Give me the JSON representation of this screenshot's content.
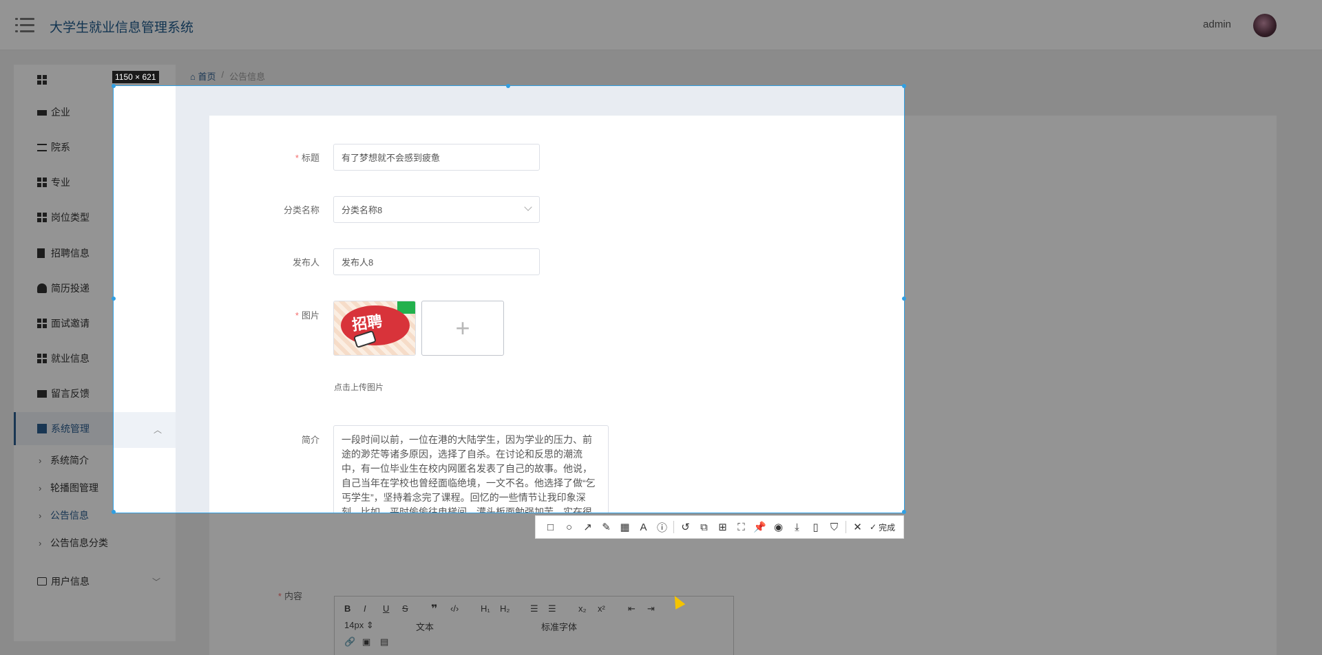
{
  "header": {
    "title": "大学生就业信息管理系统",
    "user": "admin"
  },
  "sidebar": {
    "items": [
      {
        "label": "企业",
        "icon": "store-icon"
      },
      {
        "label": "院系",
        "icon": "list-icon"
      },
      {
        "label": "专业",
        "icon": "grid-icon"
      },
      {
        "label": "岗位类型",
        "icon": "grid-icon"
      },
      {
        "label": "招聘信息",
        "icon": "clipboard-icon"
      },
      {
        "label": "简历投递",
        "icon": "user-icon"
      },
      {
        "label": "面试邀请",
        "icon": "grid-icon"
      },
      {
        "label": "就业信息",
        "icon": "grid-icon"
      },
      {
        "label": "留言反馈",
        "icon": "briefcase-icon"
      },
      {
        "label": "系统管理",
        "icon": "settings-icon"
      }
    ],
    "sub_items": [
      "系统简介",
      "轮播图管理",
      "公告信息",
      "公告信息分类"
    ],
    "user_info": "用户信息"
  },
  "breadcrumb": {
    "home": "首页",
    "current": "公告信息"
  },
  "form": {
    "title_label": "标题",
    "title_value": "有了梦想就不会感到疲惫",
    "category_label": "分类名称",
    "category_value": "分类名称8",
    "publisher_label": "发布人",
    "publisher_value": "发布人8",
    "image_label": "图片",
    "image_text": "招聘",
    "upload_hint": "点击上传图片",
    "summary_label": "简介",
    "summary_value": "一段时间以前，一位在港的大陆学生，因为学业的压力、前途的渺茫等诸多原因，选择了自杀。在讨论和反思的潮流中，有一位毕业生在校内网匿名发表了自己的故事。他说，自己当年在学校也曾经面临绝境，一文不名。他选择了做“乞丐学生”，坚持着念完了课程。回忆的一些情节让我印象深刻，比如，平时偷偷往电梯间，灌头板面勉强加苦，实在很饿，学校举办餐会的时候就进场埋头大吃",
    "content_label": "内容"
  },
  "editor": {
    "font_size": "14px",
    "block_type": "文本",
    "font_family": "标准字体"
  },
  "capture": {
    "size_label": "1150 × 621",
    "done_label": "完成"
  }
}
